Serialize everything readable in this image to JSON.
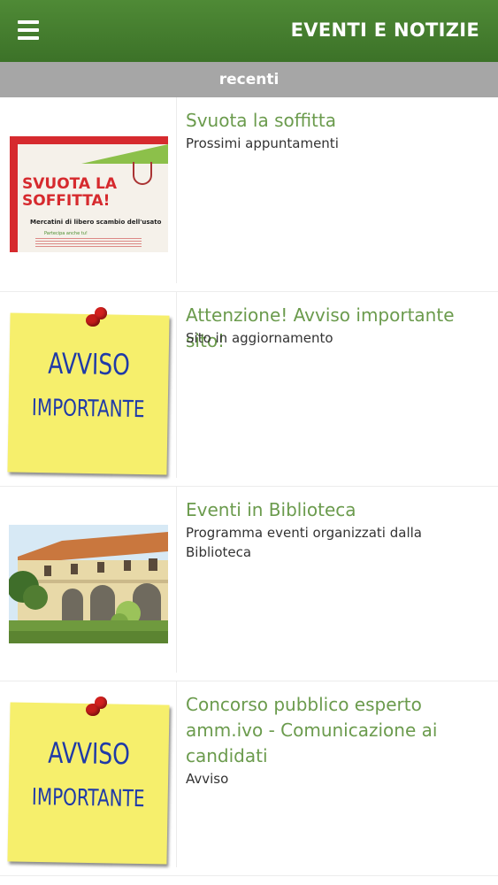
{
  "header": {
    "title": "EVENTI E NOTIZIE",
    "menu_icon": "hamburger-menu-icon"
  },
  "subheader": {
    "label": "recenti"
  },
  "colors": {
    "header": "#4a8433",
    "subheader": "#a6a6a6",
    "item_title": "#6b9b4d"
  },
  "items": [
    {
      "title": "Svuota la soffitta",
      "subtitle": "Prossimi appuntamenti",
      "image": {
        "headline": "SVUOTA LA SOFFITTA!",
        "tagline": "Mercatini di libero scambio dell'usato",
        "partecipa": "Partecipa anche tu!"
      }
    },
    {
      "title": "Attenzione! Avviso importante sito!",
      "subtitle": "Sito in aggiornamento",
      "image": {
        "line1": "AVVISO",
        "line2": "IMPORTANTE"
      }
    },
    {
      "title": "Eventi in Biblioteca",
      "subtitle": "Programma eventi organizzati dalla Biblioteca",
      "image": {}
    },
    {
      "title": "Concorso pubblico esperto amm.ivo - Comunicazione ai candidati",
      "subtitle": "Avviso",
      "image": {
        "line1": "AVVISO",
        "line2": "IMPORTANTE"
      }
    }
  ]
}
